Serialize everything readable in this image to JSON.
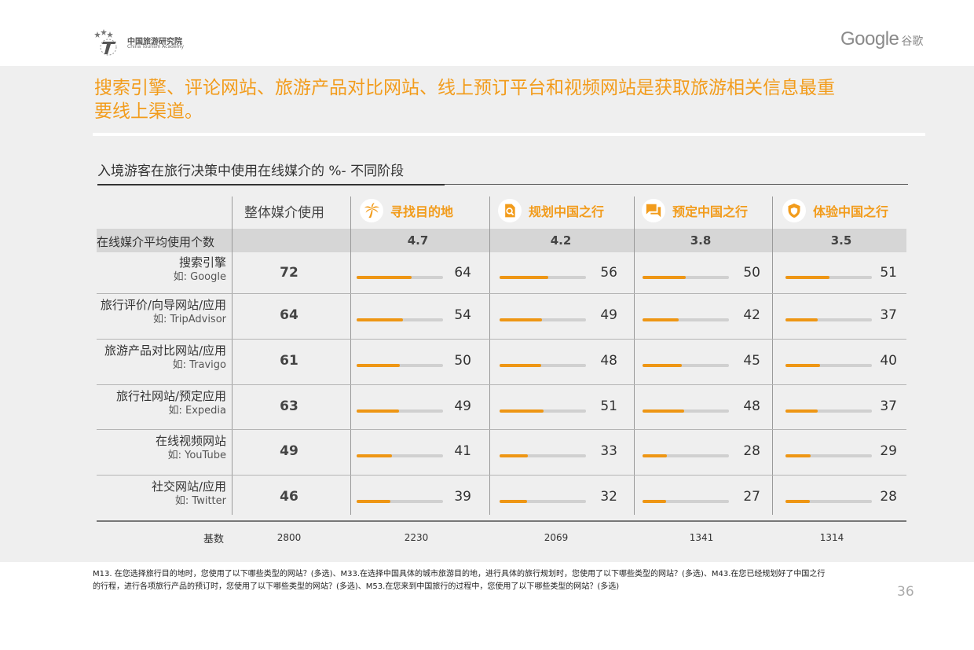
{
  "header": {
    "org_cn": "中国旅游研究院",
    "org_en": "China Tourism Academy",
    "brand": "Google",
    "brand_cn": "谷歌"
  },
  "headline": "搜索引擎、评论网站、旅游产品对比网站、线上预订平台和视频网站是获取旅游相关信息最重要线上渠道。",
  "subtitle": "入境游客在旅行决策中使用在线媒介的 %- 不同阶段",
  "columns": {
    "overall": "整体媒介使用",
    "stages": [
      {
        "label": "寻找目的地",
        "icon": "palm-tree-icon"
      },
      {
        "label": "规划中国之行",
        "icon": "search-document-icon"
      },
      {
        "label": "预定中国之行",
        "icon": "chat-bubble-icon"
      },
      {
        "label": "体验中国之行",
        "icon": "shield-icon"
      }
    ]
  },
  "average_row": {
    "label": "在线媒介平均使用个数",
    "values": [
      "4.7",
      "4.2",
      "3.8",
      "3.5"
    ]
  },
  "rows": [
    {
      "name": "搜索引擎",
      "example": "如: Google",
      "overall": "72",
      "values": [
        64,
        56,
        50,
        51
      ]
    },
    {
      "name": "旅行评价/向导网站/应用",
      "example": "如: TripAdvisor",
      "overall": "64",
      "values": [
        54,
        49,
        42,
        37
      ]
    },
    {
      "name": "旅游产品对比网站/应用",
      "example": "如: Travigo",
      "overall": "61",
      "values": [
        50,
        48,
        45,
        40
      ]
    },
    {
      "name": "旅行社网站/预定应用",
      "example": "如: Expedia",
      "overall": "63",
      "values": [
        49,
        51,
        48,
        37
      ]
    },
    {
      "name": "在线视频网站",
      "example": "如: YouTube",
      "overall": "49",
      "values": [
        41,
        33,
        28,
        29
      ]
    },
    {
      "name": "社交网站/应用",
      "example": "如: Twitter",
      "overall": "46",
      "values": [
        39,
        32,
        27,
        28
      ]
    }
  ],
  "base": {
    "label": "基数",
    "values": [
      "2800",
      "2230",
      "2069",
      "1341",
      "1314"
    ]
  },
  "footnote": "M13. 在您选择旅行目的地时，您使用了以下哪些类型的网站？(多选)、M33.在选择中国具体的城市旅游目的地，进行具体的旅行规划时，您使用了以下哪些类型的网站？(多选)、M43.在您已经规划好了中国之行的行程，进行各项旅行产品的预订时，您使用了以下哪些类型的网站？(多选)、M53.在您来到中国旅行的过程中，您使用了以下哪些类型的网站？(多选)",
  "page_number": "36",
  "colors": {
    "accent": "#f29c1c",
    "bar_fill": "#ee9614",
    "bar_track": "#d0d0d0",
    "panel_bg": "#efefef"
  }
}
